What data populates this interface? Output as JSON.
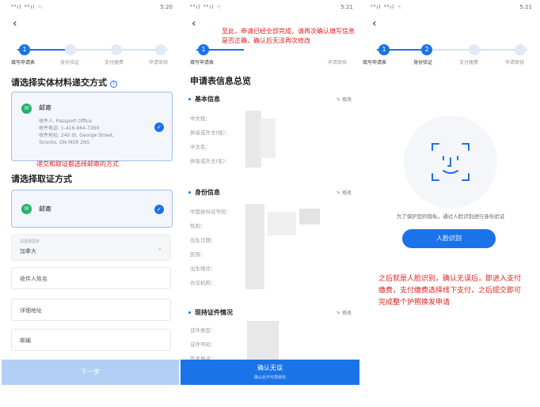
{
  "status": {
    "signal": "⁴⁶ıl ⁴⁶ıl ☜",
    "time1": "5:20",
    "time2": "5:21",
    "time3": "5:21",
    "battery": "✻ ▭"
  },
  "steps": {
    "s1": "填写申请表",
    "s2": "身份验证",
    "s3": "支付缴费",
    "s4": "申请审核",
    "n1": "1",
    "n2": "2"
  },
  "p1": {
    "title1": "请选择实体材料递交方式",
    "card1": {
      "name": "邮寄",
      "line1": "收件人: Passport Office",
      "line2": "收件电话: 1-416-964-7260",
      "line3": "收件地址: 240 St. George Street,",
      "line4": "Toronto, ON M5R 2N5"
    },
    "note": "递交和取证都选择邮寄的方式",
    "title2": "请选择取证方式",
    "card2": {
      "name": "邮寄"
    },
    "country_label": "请选择国家",
    "country_value": "加拿大",
    "fields": [
      "收件人姓名",
      "详细地址",
      "邮编"
    ],
    "next": "下一步"
  },
  "p2": {
    "overlay": "至此，申请已经全部完成，请再次确认填写信息是否正确，确认后无法再次修改",
    "title": "申请表信息总览",
    "edit": "修改",
    "sec1": "基本信息",
    "basic": [
      "中文姓：",
      "拼音或外文(姓)：",
      "中文名：",
      "拼音或外文(名)："
    ],
    "sec2": "身份信息",
    "id": [
      "中国身份证号码：",
      "性别：",
      "出生日期：",
      "民族：",
      "出生地点：",
      "办证机构："
    ],
    "sec3": "现持证件情况",
    "cert": [
      "证件类型：",
      "证件号码：",
      "签发地点："
    ],
    "confirm": "确认无误",
    "confirm_sub": "确认后不可再修改"
  },
  "p3": {
    "hint": "为了保护您的隐私，通过人脸识别进行身份验证",
    "face_btn": "人脸识别",
    "note": "之后就是人脸识别，确认无误后，即进入支付缴费，支付缴费选择线下支付，之后提交即可完成整个护照换发申请"
  },
  "colors": {
    "accent": "#1a73e8",
    "red": "#e02020",
    "green": "#1fb36b"
  }
}
